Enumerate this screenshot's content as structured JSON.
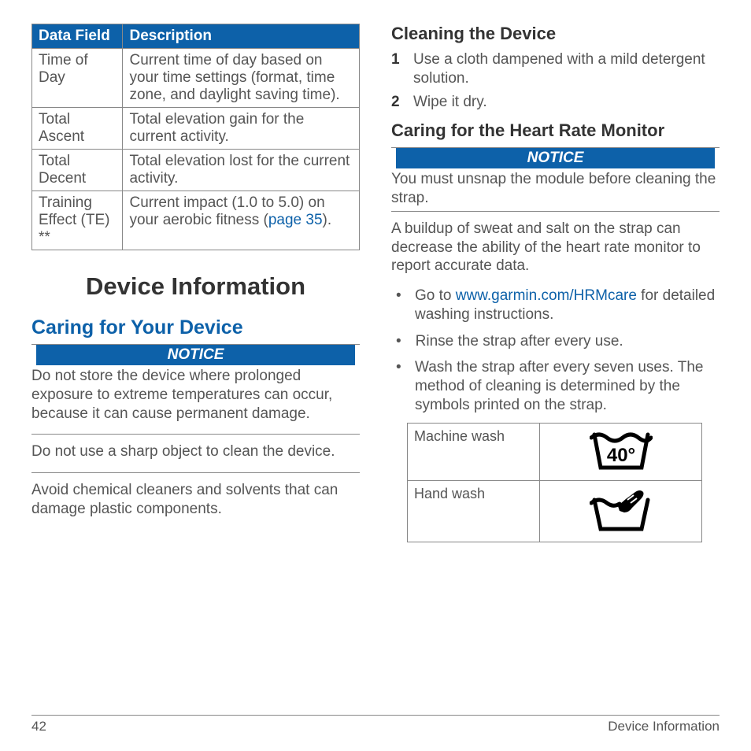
{
  "table": {
    "headers": [
      "Data Field",
      "Description"
    ],
    "rows": [
      {
        "field": "Time of Day",
        "desc": "Current time of day based on your time settings (format, time zone, and daylight saving time)."
      },
      {
        "field": "Total Ascent",
        "desc": "Total elevation gain for the current activity."
      },
      {
        "field": "Total Decent",
        "desc": "Total elevation lost for the current activity."
      },
      {
        "field": "Training Effect (TE) **",
        "desc_pre": "Current impact (1.0 to 5.0) on your aerobic fitness (",
        "desc_link": "page 35",
        "desc_post": ")."
      }
    ]
  },
  "section_title": "Device Information",
  "caring_heading": "Caring for Your Device",
  "notice_label": "NOTICE",
  "notice1": "Do not store the device where prolonged exposure to extreme temperatures can occur, because it can cause permanent damage.",
  "para_sharp": "Do not use a sharp object to clean the device.",
  "para_chem": "Avoid chemical cleaners and solvents that can damage plastic components.",
  "cleaning_heading": "Cleaning the Device",
  "cleaning_steps": [
    "Use a cloth dampened with a mild detergent solution.",
    "Wipe it dry."
  ],
  "hrm_heading": "Caring for the Heart Rate Monitor",
  "hrm_notice": "You must unsnap the module before cleaning the strap.",
  "hrm_para": "A buildup of sweat and salt on the strap can decrease the ability of the heart rate monitor to report accurate data.",
  "hrm_bullets": {
    "b1_pre": "Go to ",
    "b1_link": "www.garmin.com/HRMcare",
    "b1_post": " for detailed washing instructions.",
    "b2": "Rinse the strap after every use.",
    "b3": "Wash the strap after every seven uses. The method of cleaning is determined by the symbols printed on the strap."
  },
  "wash_table": {
    "row1_label": "Machine wash",
    "row1_temp": "40°",
    "row2_label": "Hand wash"
  },
  "footer": {
    "page": "42",
    "section": "Device Information"
  }
}
